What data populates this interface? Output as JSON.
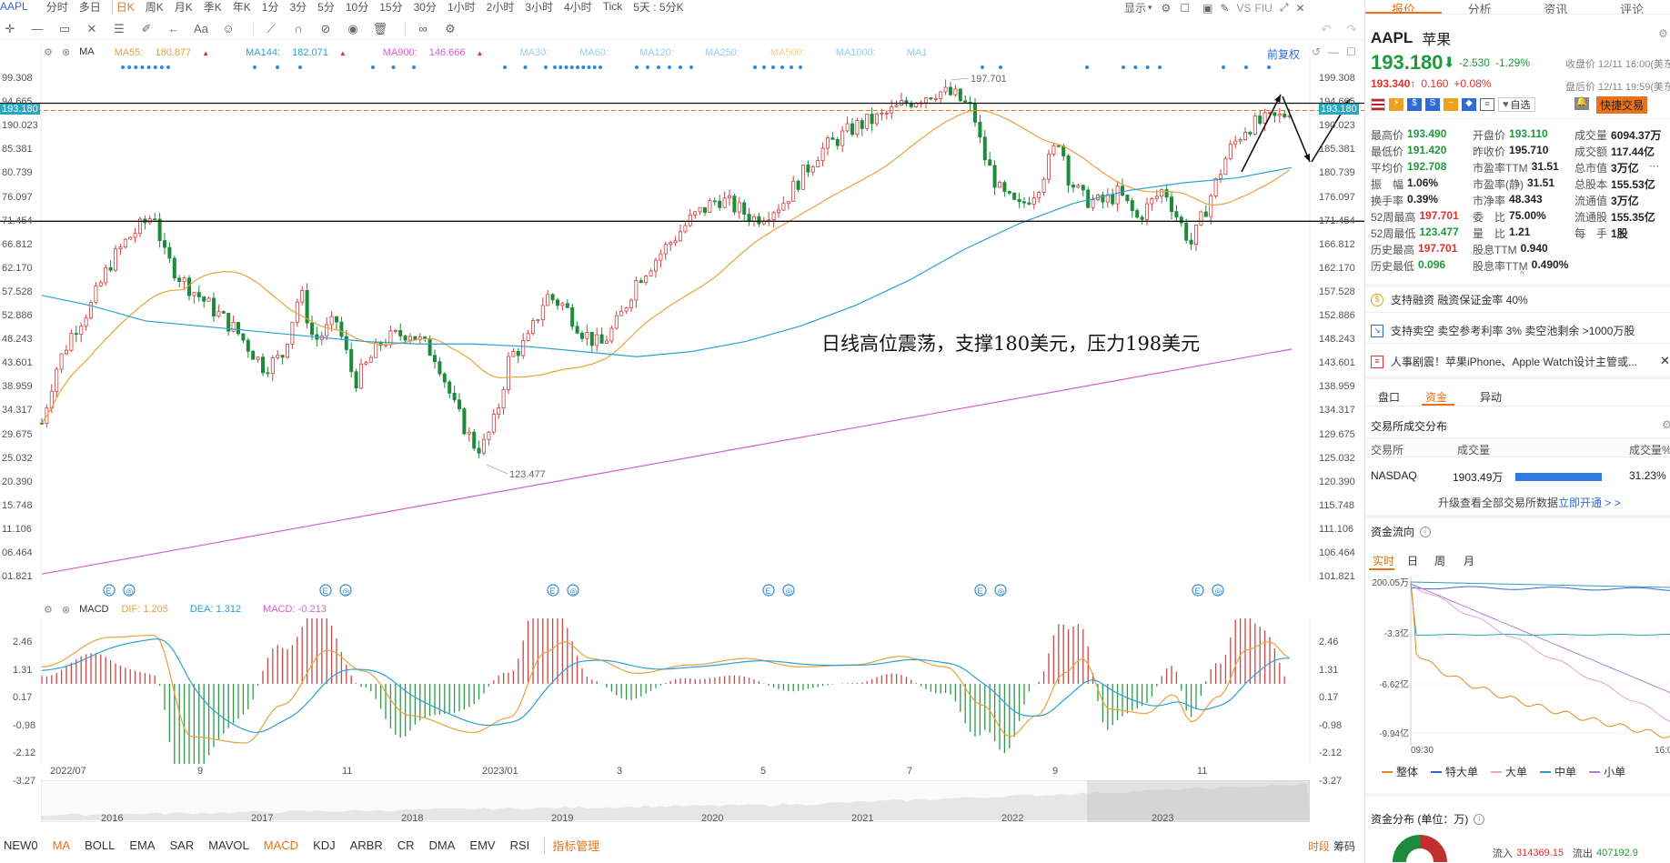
{
  "toolbar": {
    "periods": [
      "AAPL",
      "分时",
      "多日",
      "日K",
      "周K",
      "月K",
      "季K",
      "年K",
      "1分",
      "3分",
      "5分",
      "10分",
      "15分",
      "30分",
      "1小时",
      "2小时",
      "3小时",
      "4小时",
      "Tick",
      "5天 : 5分K"
    ],
    "display_label": "显示",
    "right_labels": [
      "VS",
      "FIU"
    ]
  },
  "ma_legend": {
    "ma_label": "MA",
    "items": [
      {
        "text": "MA55: ",
        "value": "180.877",
        "color": "#e8a33a"
      },
      {
        "text": "MA144: ",
        "value": "182.071",
        "color": "#2aa0d8"
      },
      {
        "text": "MA900: ",
        "value": "146.666",
        "color": "#d45fd0"
      },
      {
        "text": "MA30:",
        "value": "",
        "color": "#9ccbe8"
      },
      {
        "text": "MA60:",
        "value": "",
        "color": "#9ccbe8"
      },
      {
        "text": "MA120:",
        "value": "",
        "color": "#9ccbe8"
      },
      {
        "text": "MA250:",
        "value": "",
        "color": "#9ccbe8"
      },
      {
        "text": "MA500:",
        "value": "",
        "color": "#f2cf9a"
      },
      {
        "text": "MA1000:",
        "value": "",
        "color": "#9ccbe8"
      },
      {
        "text": "MA1",
        "value": "",
        "color": "#9ccbe8"
      }
    ],
    "restore": "前复权"
  },
  "main_axis": {
    "left": [
      "99.308",
      "94.665",
      "190.023",
      "85.381",
      "80.739",
      "76.097",
      "71.454",
      "66.812",
      "62.170",
      "57.528",
      "52.886",
      "48.243",
      "43.601",
      "38.959",
      "34.317",
      "29.675",
      "25.032",
      "20.390",
      "15.748",
      "11.106",
      "06.464",
      "01.821"
    ],
    "right": [
      "199.308",
      "194.665",
      "190.023",
      "185.381",
      "180.739",
      "176.097",
      "171.454",
      "166.812",
      "162.170",
      "157.528",
      "152.886",
      "148.243",
      "143.601",
      "138.959",
      "134.317",
      "129.675",
      "125.032",
      "120.390",
      "115.748",
      "111.106",
      "106.464",
      "101.821"
    ],
    "current_price": "193.180",
    "high_label": "197.701",
    "low_label": "123.477"
  },
  "annotation": "日线高位震荡，支撑180美元，压力198美元",
  "macd_legend": {
    "label": "MACD",
    "dif": "DIF: 1.205",
    "dea": "DEA: 1.312",
    "macd": "MACD: -0.213"
  },
  "macd_axis": [
    "2.46",
    "1.31",
    "0.17",
    "-0.98",
    "-2.12",
    "-3.27"
  ],
  "x_axis": [
    "2022/07",
    "9",
    "11",
    "2023/01",
    "3",
    "5",
    "7",
    "9",
    "11"
  ],
  "overview_years": [
    "2016",
    "2017",
    "2018",
    "2019",
    "2020",
    "2021",
    "2022",
    "2023"
  ],
  "bottom_tabs": {
    "items": [
      "NEW0",
      "MA",
      "BOLL",
      "EMA",
      "SAR",
      "MAVOL",
      "MACD",
      "KDJ",
      "ARBR",
      "CR",
      "DMA",
      "EMV",
      "RSI",
      "指标管理"
    ],
    "right": [
      "时段",
      "筹码"
    ]
  },
  "right_panel": {
    "tabs": [
      "报价",
      "分析",
      "资讯",
      "评论"
    ],
    "ticker": "AAPL",
    "name": "苹果",
    "price": "193.180",
    "arrow": "⬇",
    "change": "-2.530",
    "change_pct": "-1.29%",
    "close_time": "收盘价 12/11 16:00(美东",
    "after_price": "193.340",
    "after_arrow": "↑",
    "after_change": "0.160",
    "after_pct": "+0.08%",
    "after_time": "盘后价 12/11 19:59(美东",
    "watch_label": "自选",
    "fast_trade": "快捷交易",
    "quote": [
      [
        {
          "k": "最高价",
          "v": "193.490",
          "c": "green"
        },
        {
          "k": "开盘价",
          "v": "193.110",
          "c": "green"
        },
        {
          "k": "成交量",
          "v": "6094.37万",
          "c": "dark"
        }
      ],
      [
        {
          "k": "最低价",
          "v": "191.420",
          "c": "green"
        },
        {
          "k": "昨收价",
          "v": "195.710",
          "c": "dark"
        },
        {
          "k": "成交额",
          "v": "117.44亿",
          "c": "dark"
        }
      ],
      [
        {
          "k": "平均价",
          "v": "192.708",
          "c": "green"
        },
        {
          "k": "市盈率TTM",
          "v": "31.51",
          "c": "dark"
        },
        {
          "k": "总市值",
          "v": "3万亿",
          "c": "dark"
        }
      ],
      [
        {
          "k": "振　幅",
          "v": "1.06%",
          "c": "dark"
        },
        {
          "k": "市盈率(静)",
          "v": "31.51",
          "c": "dark"
        },
        {
          "k": "总股本",
          "v": "155.53亿",
          "c": "dark"
        }
      ],
      [
        {
          "k": "换手率",
          "v": "0.39%",
          "c": "dark"
        },
        {
          "k": "市净率",
          "v": "48.343",
          "c": "dark"
        },
        {
          "k": "流通值",
          "v": "3万亿",
          "c": "dark"
        }
      ],
      [
        {
          "k": "52周最高",
          "v": "197.701",
          "c": "red"
        },
        {
          "k": "委　比",
          "v": "75.00%",
          "c": "dark"
        },
        {
          "k": "流通股",
          "v": "155.35亿",
          "c": "dark"
        }
      ],
      [
        {
          "k": "52周最低",
          "v": "123.477",
          "c": "green"
        },
        {
          "k": "量　比",
          "v": "1.21",
          "c": "dark"
        },
        {
          "k": "每　手",
          "v": "1股",
          "c": "dark"
        }
      ],
      [
        {
          "k": "历史最高",
          "v": "197.701",
          "c": "red"
        },
        {
          "k": "股息TTM",
          "v": "0.940",
          "c": "dark"
        },
        {
          "k": "",
          "v": "",
          "c": "dark"
        }
      ],
      [
        {
          "k": "历史最低",
          "v": "0.096",
          "c": "green"
        },
        {
          "k": "股息率TTM",
          "v": "0.490%",
          "c": "dark"
        },
        {
          "k": "",
          "v": "",
          "c": "dark"
        }
      ]
    ],
    "notices": [
      "支持融资 融资保证金率 40%",
      "支持卖空 卖空参考利率 3% 卖空池剩余 >1000万股",
      "人事剧震！苹果iPhone、Apple Watch设计主管或..."
    ],
    "sub_tabs": [
      "盘口",
      "资金",
      "异动"
    ],
    "exchange_title": "交易所成交分布",
    "exchange_headers": [
      "交易所",
      "成交量",
      "成交量%"
    ],
    "exchange_row": {
      "name": "NASDAQ",
      "vol": "1903.49万",
      "pct": "31.23%",
      "bar_fill": 1.0
    },
    "upgrade_text": "升级查看全部交易所数据",
    "upgrade_link": "立即开通 > >",
    "flow_title": "资金流向",
    "flow_tabs": [
      "实时",
      "日",
      "周",
      "月"
    ],
    "flow_axis": [
      "200.05万",
      "-3.3亿",
      "-6.62亿",
      "-9.94亿"
    ],
    "flow_time": [
      "09:30",
      "16:0"
    ],
    "flow_legend": [
      {
        "name": "整体",
        "color": "#e08a1e"
      },
      {
        "name": "特大单",
        "color": "#2f6bd6"
      },
      {
        "name": "大单",
        "color": "#e5a0dc"
      },
      {
        "name": "中单",
        "color": "#2aa0b8"
      },
      {
        "name": "小单",
        "color": "#b07fd8"
      }
    ],
    "dist_title": "资金分布 (单位：万)",
    "inflow_label": "流入",
    "inflow": "314369.15",
    "outflow_label": "流出",
    "outflow": "407192.9"
  }
}
